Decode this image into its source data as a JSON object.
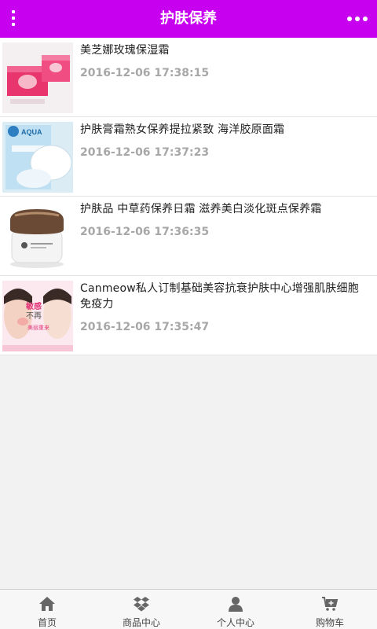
{
  "header": {
    "title": "护肤保养",
    "menu_icon": "vertical-dots-menu-icon",
    "more_icon": "horizontal-dots-more-icon",
    "background_color": "#c800f0"
  },
  "items": [
    {
      "name": "美芝娜玫瑰保湿霜",
      "date": "2016-12-06 17:38:15"
    },
    {
      "name": "护肤膏霜熟女保养提拉紧致 海洋胶原面霜",
      "date": "2016-12-06 17:37:23"
    },
    {
      "name": "护肤品 中草药保养日霜 滋养美白淡化斑点保养霜",
      "date": "2016-12-06 17:36:35"
    },
    {
      "name": "Canmeow私人订制基础美容抗衰护肤中心增强肌肤细胞免疫力",
      "date": "2016-12-06 17:35:47"
    }
  ],
  "image_text": {
    "aqua_brand": "AQUA",
    "banner_line1": "敏感",
    "banner_line2": "不再",
    "banner_line3": "美丽重来"
  },
  "bottom_nav": [
    {
      "label": "首页",
      "icon": "home-icon"
    },
    {
      "label": "商品中心",
      "icon": "dropbox-icon"
    },
    {
      "label": "个人中心",
      "icon": "user-icon"
    },
    {
      "label": "购物车",
      "icon": "cart-icon"
    }
  ]
}
